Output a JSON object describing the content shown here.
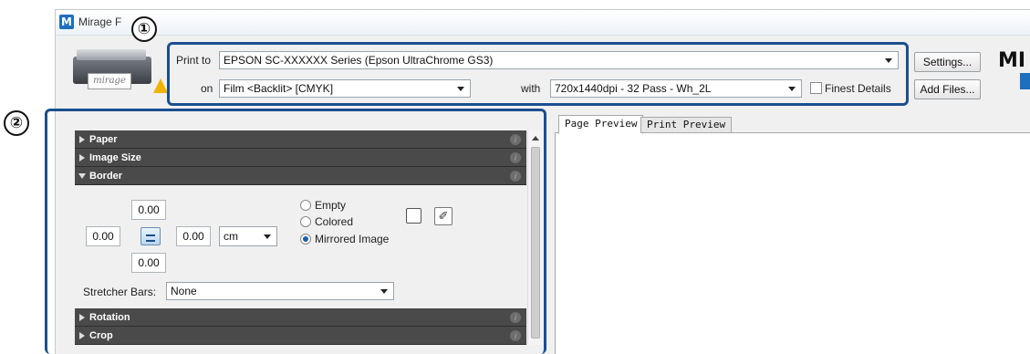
{
  "window": {
    "title": "Mirage F",
    "app_icon": "M"
  },
  "callouts": {
    "one": "①",
    "two": "②"
  },
  "printer": {
    "label": "mirage"
  },
  "print_settings": {
    "print_to_label": "Print to",
    "printer_value": "EPSON SC-XXXXXX Series (Epson UltraChrome GS3)",
    "on_label": "on",
    "media_value": "Film <Backlit> [CMYK]",
    "with_label": "with",
    "quality_value": "720x1440dpi - 32 Pass - Wh_2L",
    "finest_details_label": "Finest Details",
    "finest_details_checked": false
  },
  "buttons": {
    "settings": "Settings...",
    "add_files": "Add Files..."
  },
  "logo": "MI",
  "sections": {
    "paper": "Paper",
    "image_size": "Image Size",
    "border": "Border",
    "rotation": "Rotation",
    "crop": "Crop"
  },
  "border": {
    "top": "0.00",
    "left": "0.00",
    "right": "0.00",
    "bottom": "0.00",
    "unit": "cm",
    "options": [
      "Empty",
      "Colored",
      "Mirrored Image"
    ],
    "selected": "Mirrored Image",
    "stretcher_label": "Stretcher Bars:",
    "stretcher_value": "None"
  },
  "tabs": [
    "Page Preview",
    "Print Preview"
  ],
  "active_tab": "Page Preview"
}
